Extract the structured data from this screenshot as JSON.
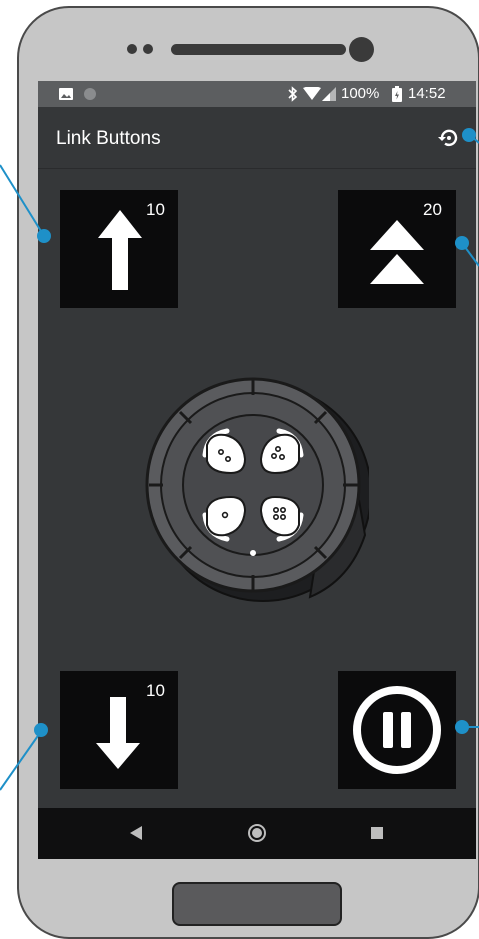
{
  "status_bar": {
    "battery": "100%",
    "time": "14:52"
  },
  "app_bar": {
    "title": "Link Buttons"
  },
  "tiles": {
    "up": {
      "count": "10",
      "icon": "arrow-up-icon"
    },
    "double_up": {
      "count": "20",
      "icon": "double-up-icon"
    },
    "down": {
      "count": "10",
      "icon": "arrow-down-icon"
    },
    "pause": {
      "icon": "pause-icon"
    }
  },
  "nav_bar": {
    "back": "back-icon",
    "home": "home-icon",
    "recents": "recents-icon"
  },
  "colors": {
    "screen_bg": "#353739",
    "status_bg": "#5c5e60",
    "tile_bg": "#0b0b0c",
    "accent_callout": "#1e90c8",
    "phone_body": "#c6c6c6"
  }
}
